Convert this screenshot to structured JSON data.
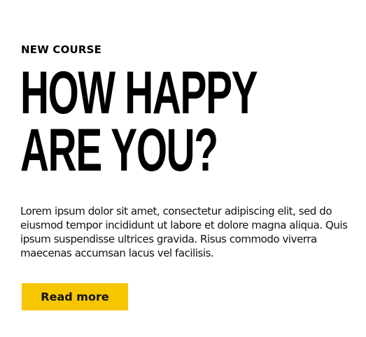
{
  "eyebrow": "NEW COURSE",
  "headline": {
    "line1": "HOW HAPPY",
    "line2": "ARE YOU?"
  },
  "body": "Lorem ipsum dolor sit amet, consectetur adipiscing elit, sed do eiusmod tempor incididunt ut labore et dolore magna aliqua. Quis ipsum suspendisse ultrices gravida. Risus commodo viverra maecenas accumsan lacus vel facilisis.",
  "cta": {
    "label": "Read more"
  },
  "colors": {
    "accent": "#f6c700",
    "text": "#000000",
    "background": "#ffffff"
  }
}
